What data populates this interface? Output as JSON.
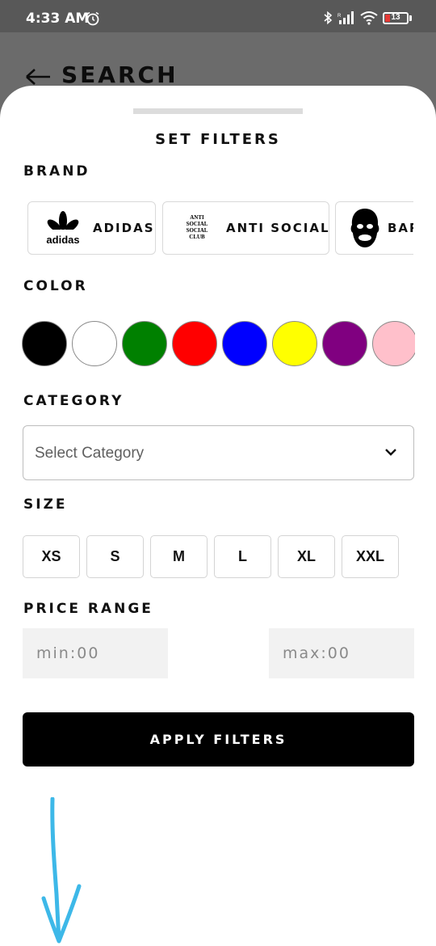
{
  "status_bar": {
    "time": "4:33 AM",
    "battery": "13",
    "icons": [
      "alarm-icon",
      "bluetooth-icon",
      "cellular-signal-icon",
      "wifi-icon",
      "battery-icon"
    ]
  },
  "header": {
    "title": "SEARCH",
    "back_icon": "arrow-left-icon"
  },
  "sheet": {
    "title": "SET FILTERS"
  },
  "brand": {
    "label": "BRAND",
    "items": [
      {
        "name": "ADIDAS",
        "logo": "adidas-logo",
        "logo_text": "adidas"
      },
      {
        "name": "ANTI SOCIAL",
        "logo": "anti-social-social-club-logo",
        "logo_text": "ANTI SOCIAL SOCIAL CLUB"
      },
      {
        "name": "BAPE",
        "logo": "bape-ape-head-logo"
      }
    ]
  },
  "color": {
    "label": "COLOR",
    "swatches": [
      "#000000",
      "#ffffff",
      "#008000",
      "#ff0000",
      "#0000ff",
      "#ffff00",
      "#800080",
      "#ffc0cb"
    ]
  },
  "category": {
    "label": "CATEGORY",
    "placeholder": "Select Category"
  },
  "size": {
    "label": "SIZE",
    "options": [
      "XS",
      "S",
      "M",
      "L",
      "XL",
      "XXL"
    ]
  },
  "price": {
    "label": "PRICE RANGE",
    "min_placeholder": "min:00",
    "max_placeholder": "max:00"
  },
  "apply_button": "APPLY FILTERS",
  "annotation": {
    "color": "#3db8e8"
  }
}
